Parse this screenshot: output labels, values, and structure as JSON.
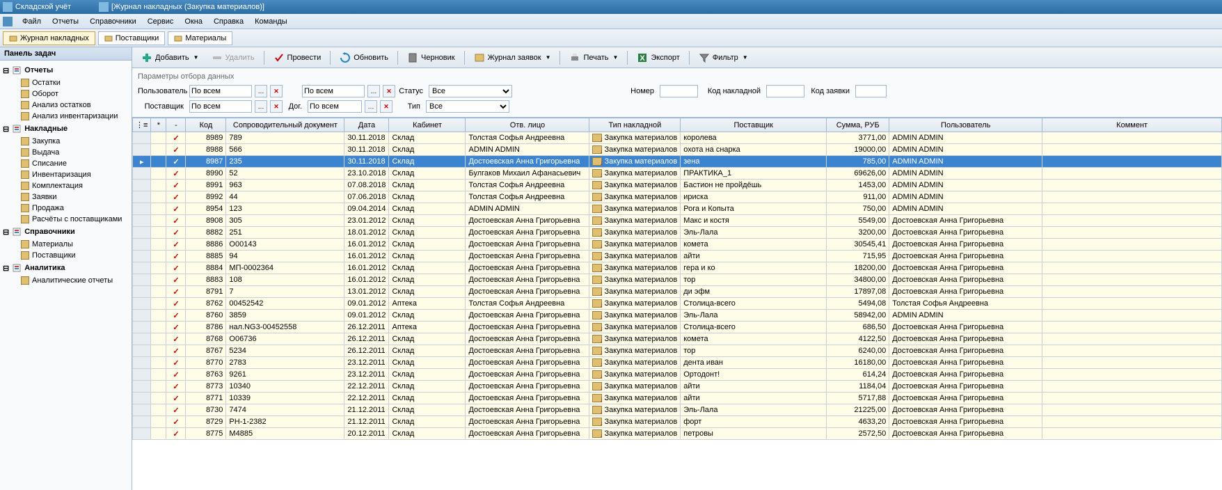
{
  "title": {
    "app": "Складской учёт",
    "doc": "[Журнал накладных (Закупка материалов)]"
  },
  "menu": [
    "Файл",
    "Отчеты",
    "Справочники",
    "Сервис",
    "Окна",
    "Справка",
    "Команды"
  ],
  "tabs": [
    {
      "label": "Журнал накладных",
      "active": true
    },
    {
      "label": "Поставщики",
      "active": false
    },
    {
      "label": "Материалы",
      "active": false
    }
  ],
  "sidebar": {
    "title": "Панель задач",
    "groups": [
      {
        "name": "Отчеты",
        "items": [
          "Остатки",
          "Оборот",
          "Анализ остатков",
          "Анализ инвентаризации"
        ]
      },
      {
        "name": "Накладные",
        "items": [
          "Закупка",
          "Выдача",
          "Списание",
          "Инвентаризация",
          "Комплектация",
          "Заявки",
          "Продажа",
          "Расчёты с поставщиками"
        ]
      },
      {
        "name": "Справочники",
        "items": [
          "Материалы",
          "Поставщики"
        ]
      },
      {
        "name": "Аналитика",
        "items": [
          "Аналитические отчеты"
        ]
      }
    ]
  },
  "toolbar": {
    "add": "Добавить",
    "delete": "Удалить",
    "post": "Провести",
    "refresh": "Обновить",
    "draft": "Черновик",
    "orders": "Журнал заявок",
    "print": "Печать",
    "export": "Экспорт",
    "filter": "Фильтр"
  },
  "filters": {
    "title": "Параметры отбора данных",
    "user_label": "Пользователь",
    "user_value": "По всем",
    "supplier_label": "Поставщик",
    "supplier_value": "По всем",
    "cabinet_label": "",
    "cabinet_value": "По всем",
    "contract_label": "Дог.",
    "contract_value": "По всем",
    "status_label": "Статус",
    "status_value": "Все",
    "type_label": "Тип",
    "type_value": "Все",
    "number_label": "Номер",
    "code_label": "Код накладной",
    "order_label": "Код заявки"
  },
  "grid": {
    "headers": {
      "rowhdr": "",
      "star": "*",
      "check": "-",
      "code": "Код",
      "doc": "Сопроводительный документ",
      "date": "Дата",
      "cabinet": "Кабинет",
      "person": "Отв. лицо",
      "type": "Тип накладной",
      "supplier": "Поставщик",
      "sum": "Сумма, РУБ",
      "user": "Пользователь",
      "comment": "Коммент"
    },
    "rows": [
      {
        "code": "8989",
        "doc": "789",
        "date": "30.11.2018",
        "cabinet": "Склад",
        "person": "Толстая Софья Андреевна",
        "type": "Закупка материалов",
        "supplier": "королева",
        "sum": "3771,00",
        "user": "ADMIN ADMIN"
      },
      {
        "code": "8988",
        "doc": "566",
        "date": "30.11.2018",
        "cabinet": "Склад",
        "person": "ADMIN ADMIN",
        "type": "Закупка материалов",
        "supplier": "охота на снарка",
        "sum": "19000,00",
        "user": "ADMIN ADMIN"
      },
      {
        "code": "8987",
        "doc": "235",
        "date": "30.11.2018",
        "cabinet": "Склад",
        "person": "Достоевская Анна Григорьевна",
        "type": "Закупка материалов",
        "supplier": "зена",
        "sum": "785,00",
        "user": "ADMIN ADMIN",
        "selected": true
      },
      {
        "code": "8990",
        "doc": "52",
        "date": "23.10.2018",
        "cabinet": "Склад",
        "person": "Булгаков Михаил Афанасьевич",
        "type": "Закупка материалов",
        "supplier": "ПРАКТИКА_1",
        "sum": "69626,00",
        "user": "ADMIN ADMIN"
      },
      {
        "code": "8991",
        "doc": "963",
        "date": "07.08.2018",
        "cabinet": "Склад",
        "person": "Толстая Софья Андреевна",
        "type": "Закупка материалов",
        "supplier": "Бастион не пройдёшь",
        "sum": "1453,00",
        "user": "ADMIN ADMIN"
      },
      {
        "code": "8992",
        "doc": "44",
        "date": "07.06.2018",
        "cabinet": "Склад",
        "person": "Толстая Софья Андреевна",
        "type": "Закупка материалов",
        "supplier": "ириска",
        "sum": "911,00",
        "user": "ADMIN ADMIN"
      },
      {
        "code": "8954",
        "doc": "123",
        "date": "09.04.2014",
        "cabinet": "Склад",
        "person": "ADMIN ADMIN",
        "type": "Закупка материалов",
        "supplier": "Рога и Копыта",
        "sum": "750,00",
        "user": "ADMIN ADMIN"
      },
      {
        "code": "8908",
        "doc": "305",
        "date": "23.01.2012",
        "cabinet": "Склад",
        "person": "Достоевская Анна Григорьевна",
        "type": "Закупка материалов",
        "supplier": "Макс и костя",
        "sum": "5549,00",
        "user": "Достоевская Анна Григорьевна"
      },
      {
        "code": "8882",
        "doc": "251",
        "date": "18.01.2012",
        "cabinet": "Склад",
        "person": "Достоевская Анна Григорьевна",
        "type": "Закупка материалов",
        "supplier": "Эль-Лала",
        "sum": "3200,00",
        "user": "Достоевская Анна Григорьевна"
      },
      {
        "code": "8886",
        "doc": "О00143",
        "date": "16.01.2012",
        "cabinet": "Склад",
        "person": "Достоевская Анна Григорьевна",
        "type": "Закупка материалов",
        "supplier": "комета",
        "sum": "30545,41",
        "user": "Достоевская Анна Григорьевна"
      },
      {
        "code": "8885",
        "doc": "94",
        "date": "16.01.2012",
        "cabinet": "Склад",
        "person": "Достоевская Анна Григорьевна",
        "type": "Закупка материалов",
        "supplier": "айти",
        "sum": "715,95",
        "user": "Достоевская Анна Григорьевна"
      },
      {
        "code": "8884",
        "doc": "МП-0002364",
        "date": "16.01.2012",
        "cabinet": "Склад",
        "person": "Достоевская Анна Григорьевна",
        "type": "Закупка материалов",
        "supplier": "гера и ко",
        "sum": "18200,00",
        "user": "Достоевская Анна Григорьевна"
      },
      {
        "code": "8883",
        "doc": "108",
        "date": "16.01.2012",
        "cabinet": "Склад",
        "person": "Достоевская Анна Григорьевна",
        "type": "Закупка материалов",
        "supplier": "тор",
        "sum": "34800,00",
        "user": "Достоевская Анна Григорьевна"
      },
      {
        "code": "8791",
        "doc": "7",
        "date": "13.01.2012",
        "cabinet": "Склад",
        "person": "Достоевская Анна Григорьевна",
        "type": "Закупка материалов",
        "supplier": "ди эфм",
        "sum": "17897,08",
        "user": "Достоевская Анна Григорьевна"
      },
      {
        "code": "8762",
        "doc": "00452542",
        "date": "09.01.2012",
        "cabinet": "Аптека",
        "person": "Толстая Софья Андреевна",
        "type": "Закупка материалов",
        "supplier": "Столица-всего",
        "sum": "5494,08",
        "user": "Толстая Софья Андреевна"
      },
      {
        "code": "8760",
        "doc": "3859",
        "date": "09.01.2012",
        "cabinet": "Склад",
        "person": "Достоевская Анна Григорьевна",
        "type": "Закупка материалов",
        "supplier": "Эль-Лала",
        "sum": "58942,00",
        "user": "ADMIN ADMIN"
      },
      {
        "code": "8786",
        "doc": "нал.NG3-00452558",
        "date": "26.12.2011",
        "cabinet": "Аптека",
        "person": "Достоевская Анна Григорьевна",
        "type": "Закупка материалов",
        "supplier": "Столица-всего",
        "sum": "686,50",
        "user": "Достоевская Анна Григорьевна"
      },
      {
        "code": "8768",
        "doc": "О06736",
        "date": "26.12.2011",
        "cabinet": "Склад",
        "person": "Достоевская Анна Григорьевна",
        "type": "Закупка материалов",
        "supplier": "комета",
        "sum": "4122,50",
        "user": "Достоевская Анна Григорьевна"
      },
      {
        "code": "8767",
        "doc": "5234",
        "date": "26.12.2011",
        "cabinet": "Склад",
        "person": "Достоевская Анна Григорьевна",
        "type": "Закупка материалов",
        "supplier": "тор",
        "sum": "6240,00",
        "user": "Достоевская Анна Григорьевна"
      },
      {
        "code": "8770",
        "doc": "2783",
        "date": "23.12.2011",
        "cabinet": "Склад",
        "person": "Достоевская Анна Григорьевна",
        "type": "Закупка материалов",
        "supplier": "дента иван",
        "sum": "16180,00",
        "user": "Достоевская Анна Григорьевна"
      },
      {
        "code": "8763",
        "doc": "9261",
        "date": "23.12.2011",
        "cabinet": "Склад",
        "person": "Достоевская Анна Григорьевна",
        "type": "Закупка материалов",
        "supplier": "Ортодонт!",
        "sum": "614,24",
        "user": "Достоевская Анна Григорьевна"
      },
      {
        "code": "8773",
        "doc": "10340",
        "date": "22.12.2011",
        "cabinet": "Склад",
        "person": "Достоевская Анна Григорьевна",
        "type": "Закупка материалов",
        "supplier": "айти",
        "sum": "1184,04",
        "user": "Достоевская Анна Григорьевна"
      },
      {
        "code": "8771",
        "doc": "10339",
        "date": "22.12.2011",
        "cabinet": "Склад",
        "person": "Достоевская Анна Григорьевна",
        "type": "Закупка материалов",
        "supplier": "айти",
        "sum": "5717,88",
        "user": "Достоевская Анна Григорьевна"
      },
      {
        "code": "8730",
        "doc": "7474",
        "date": "21.12.2011",
        "cabinet": "Склад",
        "person": "Достоевская Анна Григорьевна",
        "type": "Закупка материалов",
        "supplier": "Эль-Лала",
        "sum": "21225,00",
        "user": "Достоевская Анна Григорьевна"
      },
      {
        "code": "8729",
        "doc": "РН-1-2382",
        "date": "21.12.2011",
        "cabinet": "Склад",
        "person": "Достоевская Анна Григорьевна",
        "type": "Закупка материалов",
        "supplier": "форт",
        "sum": "4633,20",
        "user": "Достоевская Анна Григорьевна"
      },
      {
        "code": "8775",
        "doc": "М4885",
        "date": "20.12.2011",
        "cabinet": "Склад",
        "person": "Достоевская Анна Григорьевна",
        "type": "Закупка материалов",
        "supplier": "петровы",
        "sum": "2572,50",
        "user": "Достоевская Анна Григорьевна"
      }
    ]
  }
}
